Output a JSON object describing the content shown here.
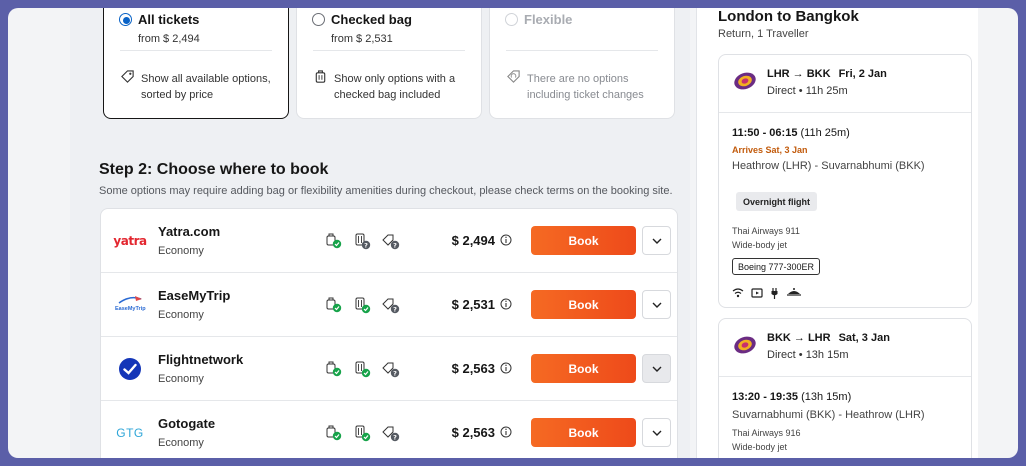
{
  "ticket_options": [
    {
      "title": "All tickets",
      "price": "from $ 2,494",
      "desc": "Show all available options, sorted by price",
      "icon": "tag-icon"
    },
    {
      "title": "Checked bag",
      "price": "from $ 2,531",
      "desc": "Show only options with a checked bag included",
      "icon": "luggage-icon"
    },
    {
      "title": "Flexible",
      "price": "",
      "desc": "There are no options including ticket changes",
      "icon": "flex-tag-icon"
    }
  ],
  "step2": {
    "title": "Step 2: Choose where to book",
    "subtitle": "Some options may require adding bag or flexibility amenities during checkout, please check terms on the booking site."
  },
  "providers": [
    {
      "logo": "yatra",
      "name": "Yatra.com",
      "cabin": "Economy",
      "price": "$ 2,494",
      "book": "Book"
    },
    {
      "logo": "EaseMyTrip",
      "name": "EaseMyTrip",
      "cabin": "Economy",
      "price": "$ 2,531",
      "book": "Book"
    },
    {
      "logo": "flightnetwork-check",
      "name": "Flightnetwork",
      "cabin": "Economy",
      "price": "$ 2,563",
      "book": "Book"
    },
    {
      "logo": "GTG",
      "name": "Gotogate",
      "cabin": "Economy",
      "price": "$ 2,563",
      "book": "Book"
    }
  ],
  "trip": {
    "title": "London to Bangkok",
    "subtitle": "Return, 1 Traveller",
    "legs": [
      {
        "route": "LHR → BKK",
        "date": "Fri, 2 Jan",
        "direct": "Direct • 11h 25m",
        "times": "11:50 - 06:15",
        "duration": "(11h 25m)",
        "arrives": "Arrives Sat, 3 Jan",
        "airports": "Heathrow (LHR) - Suvarnabhumi (BKK)",
        "badge": "Overnight flight",
        "flight_no": "Thai Airways 911",
        "body": "Wide-body jet",
        "aircraft": "Boeing 777-300ER"
      },
      {
        "route": "BKK → LHR",
        "date": "Sat, 3 Jan",
        "direct": "Direct • 13h 15m",
        "times": "13:20 - 19:35",
        "duration": "(13h 15m)",
        "airports": "Suvarnabhumi (BKK) - Heathrow (LHR)",
        "flight_no": "Thai Airways 916",
        "body": "Wide-body jet"
      }
    ]
  },
  "colors": {
    "accent": "#0a63c7",
    "book": "#f2561e",
    "arrives": "#c25b0c",
    "check": "#17a34a",
    "unknown": "#555a62"
  }
}
